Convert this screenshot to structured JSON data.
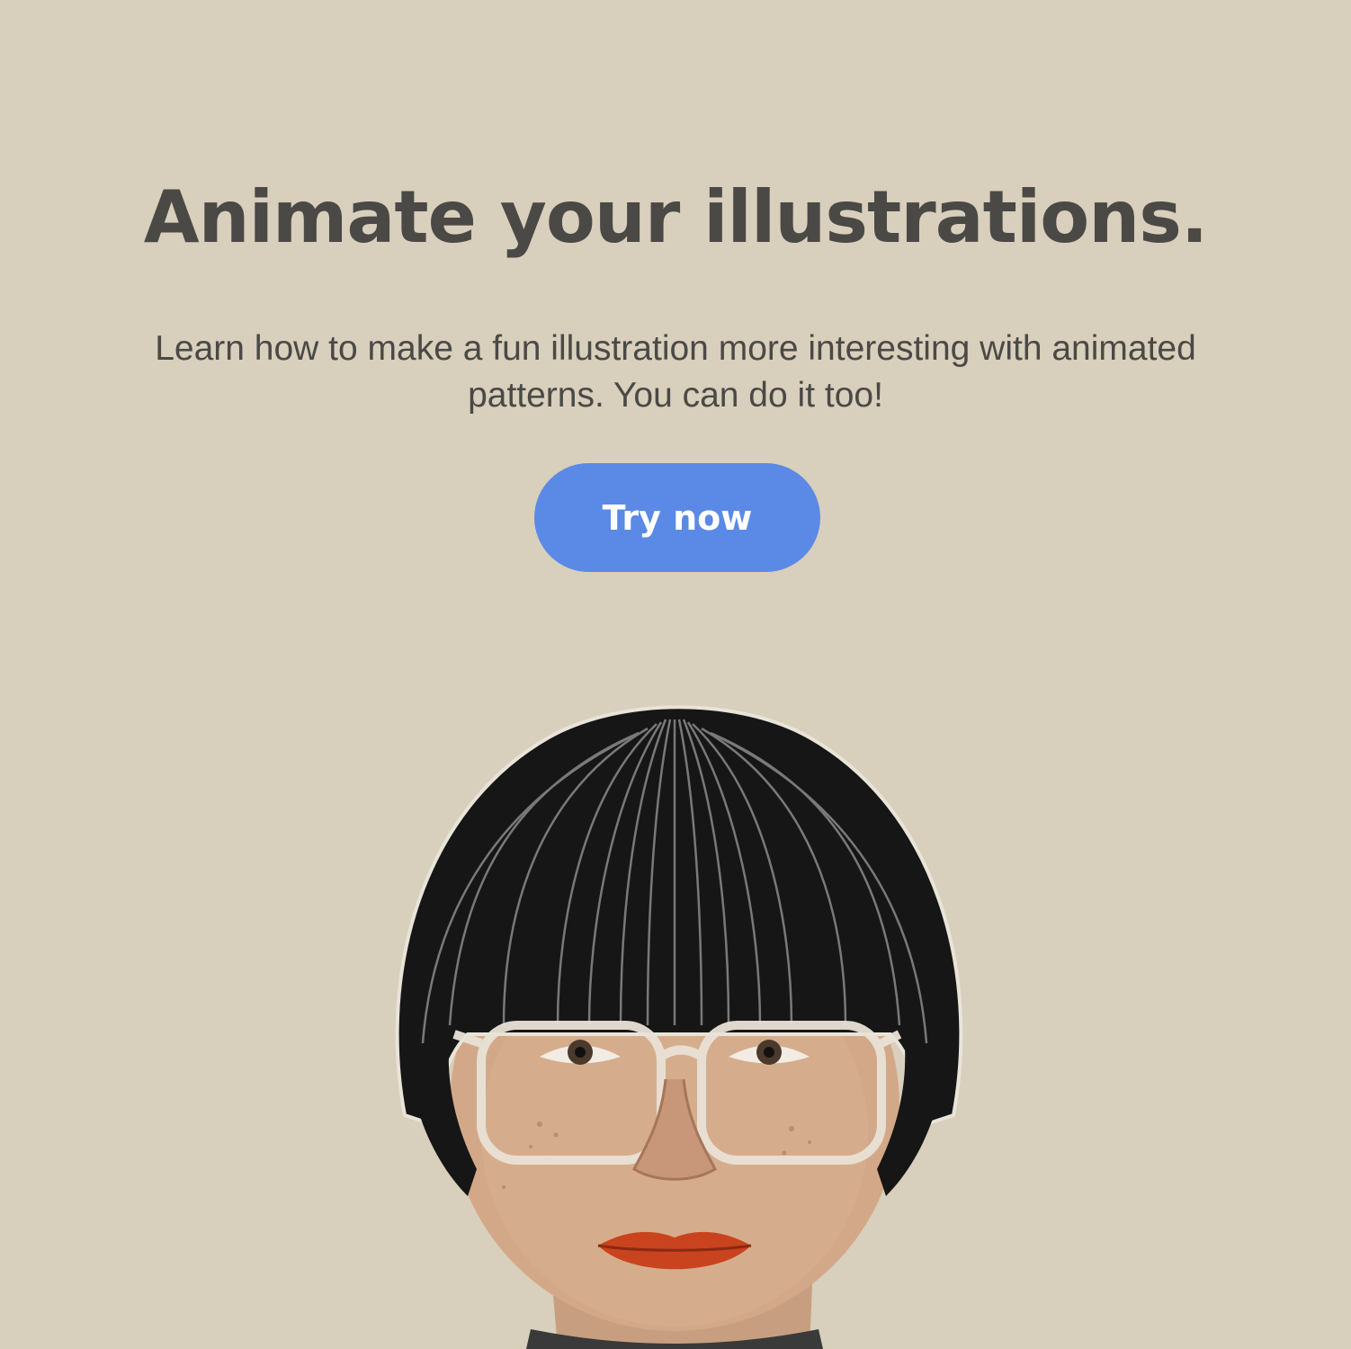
{
  "hero": {
    "headline": "Animate your illustrations.",
    "description": "Learn how to make a fun illustration more interesting with animated patterns. You can do it too!",
    "cta_label": "Try now"
  },
  "colors": {
    "background": "#d8cfbc",
    "text": "#4b4946",
    "accent": "#5b8ae6"
  },
  "illustration": {
    "icon": "portrait-illustration"
  }
}
